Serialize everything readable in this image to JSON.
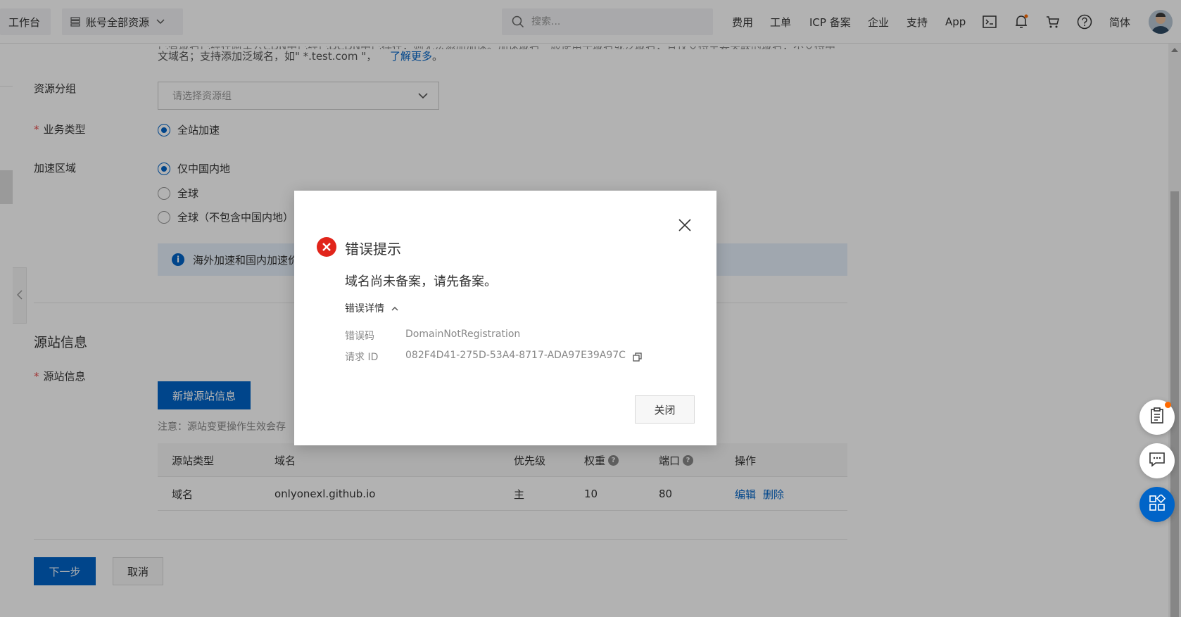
{
  "topbar": {
    "workbench": "工作台",
    "resources": "账号全部资源",
    "search_placeholder": "搜索...",
    "nav": [
      "费用",
      "工单",
      "ICP 备案",
      "企业",
      "支持",
      "App"
    ],
    "lang": "简体"
  },
  "form": {
    "top_text_line1": "已有域名已经在阿里云CDN中已经已DCDN中已存在，则无法添加加速。加速域名一般使用子域名或泛域名，且仅支持主要关联的域名，不支持中",
    "top_text_line2": "文域名；支持添加泛域名，如\" *.test.com \"，",
    "learn_more": "了解更多",
    "learn_more_suffix": "。",
    "resource_group_label": "资源分组",
    "resource_group_placeholder": "请选择资源组",
    "business_type_label": "业务类型",
    "business_type_option": "全站加速",
    "region_label": "加速区域",
    "region_options": [
      "仅中国内地",
      "全球",
      "全球（不包含中国内地）"
    ],
    "notice": "海外加速和国内加速价"
  },
  "origin": {
    "section_title": "源站信息",
    "field_label": "源站信息",
    "add_button": "新增源站信息",
    "note": "注意：源站变更操作生效会存",
    "columns": [
      "源站类型",
      "域名",
      "优先级",
      "权重",
      "端口",
      "操作"
    ],
    "rows": [
      {
        "type": "域名",
        "domain": "onlyonexl.github.io",
        "priority": "主",
        "weight": "10",
        "port": "80",
        "edit": "编辑",
        "delete": "删除"
      }
    ]
  },
  "footer": {
    "next": "下一步",
    "cancel": "取消"
  },
  "dialog": {
    "title": "错误提示",
    "message": "域名尚未备案，请先备案。",
    "detail_toggle": "错误详情",
    "error_code_label": "错误码",
    "error_code": "DomainNotRegistration",
    "request_id_label": "请求 ID",
    "request_id": "082F4D41-275D-53A4-8717-ADA97E39A97C",
    "close_button": "关闭"
  },
  "colors": {
    "primary": "#0064c8",
    "error": "#e1251b",
    "badge": "#ff6a00"
  }
}
